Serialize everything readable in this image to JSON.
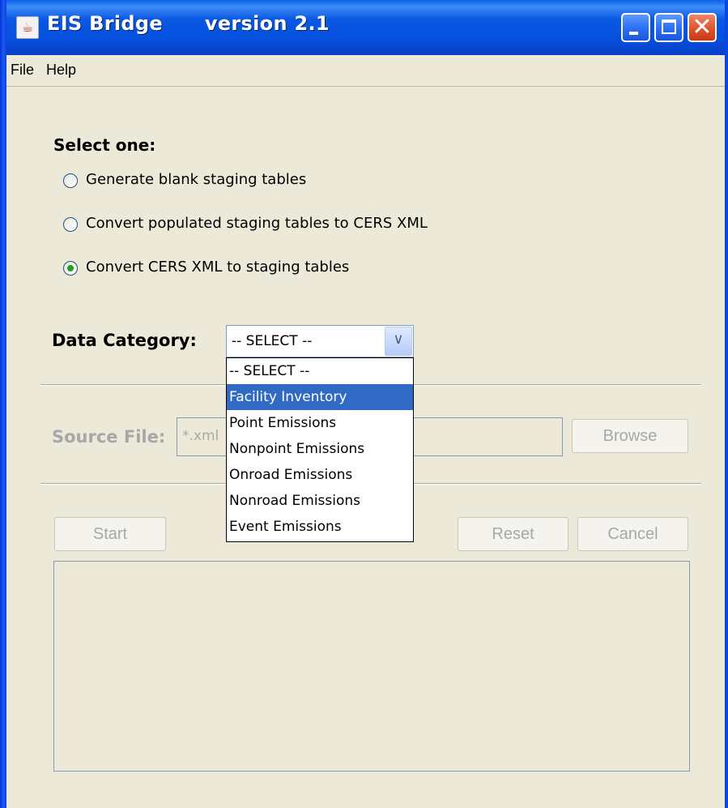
{
  "window": {
    "title": "EIS Bridge      version 2.1",
    "app_icon_glyph": "☕",
    "close_glyph": "✕"
  },
  "menu": {
    "file": "File",
    "help": "Help"
  },
  "selection": {
    "heading": "Select one:",
    "options": [
      {
        "label": "Generate blank staging tables",
        "selected": false
      },
      {
        "label": "Convert populated staging tables to CERS XML",
        "selected": false
      },
      {
        "label": "Convert CERS XML to staging tables",
        "selected": true
      }
    ]
  },
  "data_category": {
    "label": "Data Category:",
    "selected_value": "-- SELECT --",
    "options": [
      "-- SELECT --",
      "Facility Inventory",
      "Point Emissions",
      "Nonpoint Emissions",
      "Onroad Emissions",
      "Nonroad Emissions",
      "Event Emissions"
    ],
    "highlighted_index": 1
  },
  "source": {
    "label": "Source File:",
    "placeholder": "*.xml",
    "browse_label": "Browse"
  },
  "actions": {
    "start_label": "Start",
    "reset_label": "Reset",
    "cancel_label": "Cancel"
  },
  "colors": {
    "title_bar": "#0550de",
    "window_bg": "#ece9d8",
    "highlight": "#316ac5",
    "disabled_text": "#a7a6aa"
  }
}
